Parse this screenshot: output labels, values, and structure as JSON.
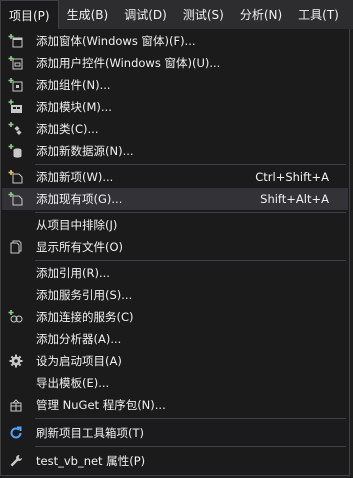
{
  "menubar": {
    "items": [
      {
        "label": "项目(P)"
      },
      {
        "label": "生成(B)"
      },
      {
        "label": "调试(D)"
      },
      {
        "label": "测试(S)"
      },
      {
        "label": "分析(N)"
      },
      {
        "label": "工具(T)"
      }
    ]
  },
  "menu": {
    "items": [
      {
        "label": "添加窗体(Windows 窗体)(F)...",
        "icon": "add-form-icon"
      },
      {
        "label": "添加用户控件(Windows 窗体)(U)...",
        "icon": "add-user-control-icon"
      },
      {
        "label": "添加组件(N)...",
        "icon": "add-component-icon"
      },
      {
        "label": "添加模块(M)...",
        "icon": "add-module-icon"
      },
      {
        "label": "添加类(C)...",
        "icon": "add-class-icon"
      },
      {
        "label": "添加新数据源(N)...",
        "icon": "add-data-source-icon"
      },
      {
        "label": "添加新项(W)...",
        "shortcut": "Ctrl+Shift+A",
        "icon": "add-new-item-icon"
      },
      {
        "label": "添加现有项(G)...",
        "shortcut": "Shift+Alt+A",
        "icon": "add-existing-item-icon"
      },
      {
        "label": "从项目中排除(J)",
        "icon": ""
      },
      {
        "label": "显示所有文件(O)",
        "icon": "show-all-files-icon"
      },
      {
        "label": "添加引用(R)...",
        "icon": ""
      },
      {
        "label": "添加服务引用(S)...",
        "icon": ""
      },
      {
        "label": "添加连接的服务(C)",
        "icon": "connected-service-icon"
      },
      {
        "label": "添加分析器(A)...",
        "icon": ""
      },
      {
        "label": "设为启动项目(A)",
        "icon": "gear-icon"
      },
      {
        "label": "导出模板(E)...",
        "icon": ""
      },
      {
        "label": "管理 NuGet 程序包(N)...",
        "icon": "nuget-package-icon"
      },
      {
        "label": "刷新项目工具箱项(T)",
        "icon": "refresh-icon"
      },
      {
        "label": "test_vb_net 属性(P)",
        "icon": "wrench-icon"
      }
    ]
  },
  "colors": {
    "background": "#1b1b1c",
    "menubar": "#2d2d30",
    "hover": "#333337",
    "text": "#f1f1f1",
    "separator": "#3f3f46",
    "icon_green": "#89d185",
    "icon_blue": "#4fa3ff"
  }
}
